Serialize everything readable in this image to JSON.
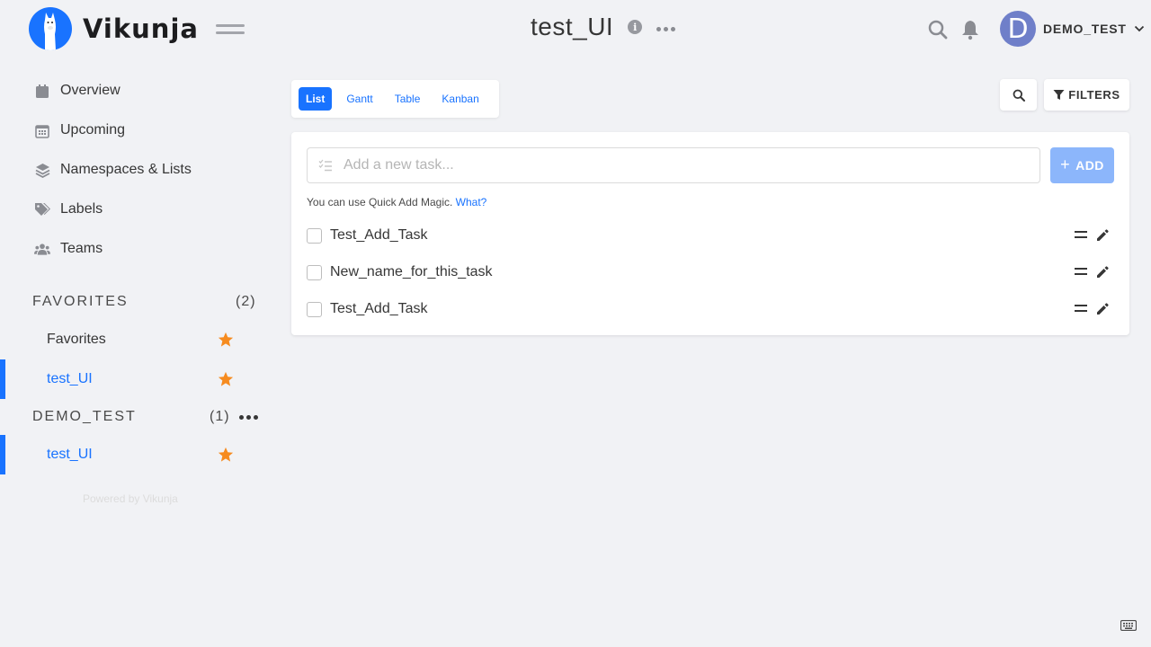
{
  "app": {
    "name": "Vikunja"
  },
  "header": {
    "project_title": "test_UI",
    "username": "DEMO_TEST",
    "avatar_letter": "D"
  },
  "sidebar": {
    "nav": [
      {
        "label": "Overview",
        "icon": "calendar-icon"
      },
      {
        "label": "Upcoming",
        "icon": "calendar-grid-icon"
      },
      {
        "label": "Namespaces & Lists",
        "icon": "layers-icon"
      },
      {
        "label": "Labels",
        "icon": "tags-icon"
      },
      {
        "label": "Teams",
        "icon": "users-icon"
      }
    ],
    "favorites": {
      "title": "FAVORITES",
      "count": "(2)",
      "items": [
        {
          "name": "Favorites",
          "active": false
        },
        {
          "name": "test_UI",
          "active": true
        }
      ]
    },
    "namespace": {
      "title": "DEMO_TEST",
      "count": "(1)",
      "items": [
        {
          "name": "test_UI",
          "active": true
        }
      ]
    },
    "powered_by": "Powered by Vikunja"
  },
  "views": {
    "tabs": [
      "List",
      "Gantt",
      "Table",
      "Kanban"
    ],
    "active": "List"
  },
  "toolbar": {
    "filters_label": "FILTERS"
  },
  "add_task": {
    "placeholder": "Add a new task...",
    "button_label": "ADD",
    "hint_text": "You can use Quick Add Magic.",
    "hint_link": "What?"
  },
  "tasks": [
    {
      "title": "Test_Add_Task",
      "done": false
    },
    {
      "title": "New_name_for_this_task",
      "done": false
    },
    {
      "title": "Test_Add_Task",
      "done": false
    }
  ],
  "colors": {
    "primary": "#1973ff",
    "star": "#f68b1f",
    "background": "#f1f2f5",
    "add_button": "#8cb6fb",
    "avatar": "#6f7fc9"
  }
}
